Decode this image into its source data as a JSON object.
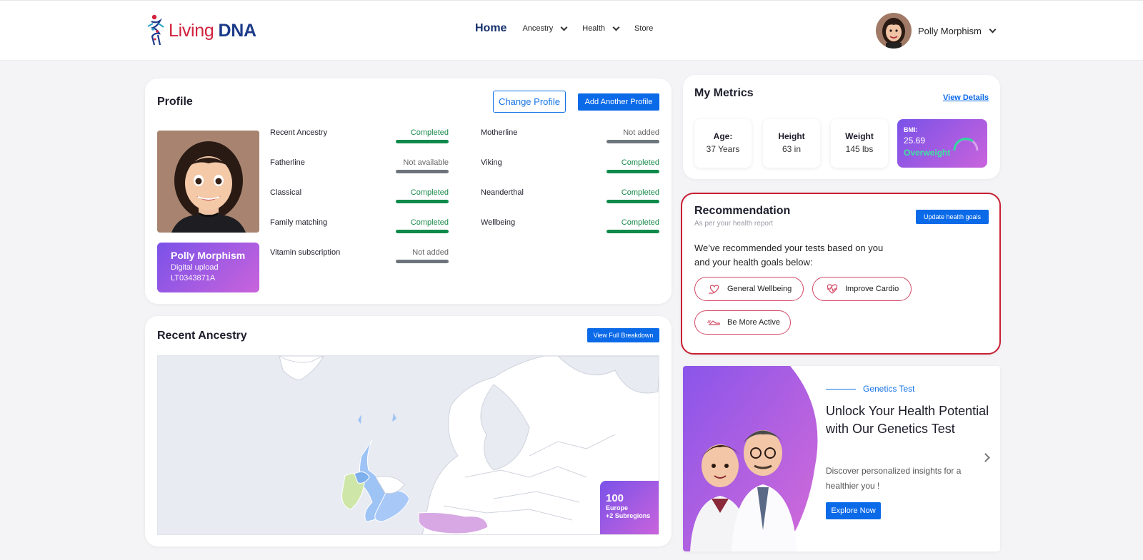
{
  "header": {
    "logo_word1": "Living",
    "logo_word2": "DNA",
    "nav": {
      "home": "Home",
      "ancestry": "Ancestry",
      "health": "Health",
      "store": "Store"
    },
    "user_name": "Polly Morphism"
  },
  "profile": {
    "title": "Profile",
    "change_label": "Change Profile",
    "add_label": "Add Another Profile",
    "name": "Polly Morphism",
    "source": "Digital upload",
    "kit_id": "LT0343871A",
    "status_left": [
      {
        "label": "Recent Ancestry",
        "status": "Completed"
      },
      {
        "label": "Fatherline",
        "status": "Not available"
      },
      {
        "label": "Classical",
        "status": "Completed"
      },
      {
        "label": "Family matching",
        "status": "Completed"
      },
      {
        "label": "Vitamin subscription",
        "status": "Not added"
      }
    ],
    "status_right": [
      {
        "label": "Motherline",
        "status": "Not added"
      },
      {
        "label": "Viking",
        "status": "Completed"
      },
      {
        "label": "Neanderthal",
        "status": "Completed"
      },
      {
        "label": "Wellbeing",
        "status": "Completed"
      }
    ]
  },
  "ancestry": {
    "title": "Recent Ancestry",
    "breakdown_label": "View Full Breakdown",
    "badge_value": "100",
    "badge_region": "Europe",
    "badge_sub": "+2 Subregions"
  },
  "metrics": {
    "title": "My Metrics",
    "view_details": "View Details",
    "age_label": "Age:",
    "age_value": "37 Years",
    "height_label": "Height",
    "height_value": "63 in",
    "weight_label": "Weight",
    "weight_value": "145 lbs",
    "bmi_label": "BMI:",
    "bmi_value": "25.69",
    "bmi_status": "Overweight",
    "colors": {
      "overweight": "#3fe3a2",
      "gauge": "#2fd6a0"
    }
  },
  "recommendation": {
    "title": "Recommendation",
    "subtitle": "As per your health report",
    "update_label": "Update health goals",
    "text": "We’ve recommended your tests based on you and your health goals below:",
    "goals": [
      {
        "label": "General Wellbeing",
        "icon": "wellbeing-icon"
      },
      {
        "label": "Improve Cardio",
        "icon": "cardio-heart-icon"
      },
      {
        "label": "Be More Active",
        "icon": "running-shoe-icon"
      }
    ]
  },
  "genetics": {
    "tag": "Genetics Test",
    "title": "Unlock Your Health Potential with Our Genetics Test",
    "desc": "Discover personalized insights for a healthier you !",
    "cta": "Explore Now"
  },
  "colors": {
    "primary": "#0b6ae8",
    "brand_red": "#d2223d",
    "brand_navy": "#1c3b8a",
    "completed": "#0e8a4a",
    "highlight_border": "#c81e32"
  }
}
